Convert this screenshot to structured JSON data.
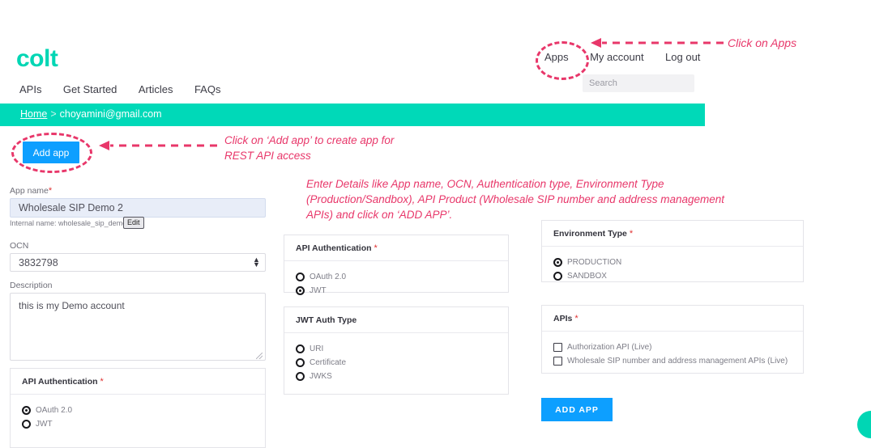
{
  "brand": {
    "logo_text": "colt",
    "logo_color": "#00d6b4",
    "bar_color": "#00d9b8"
  },
  "header": {
    "main_nav": [
      {
        "label": "APIs"
      },
      {
        "label": "Get Started"
      },
      {
        "label": "Articles"
      },
      {
        "label": "FAQs"
      }
    ],
    "user_nav": [
      {
        "label": "Apps"
      },
      {
        "label": "My account"
      },
      {
        "label": "Log out"
      }
    ],
    "search": {
      "placeholder": "Search",
      "value": ""
    }
  },
  "breadcrumb": {
    "home": "Home",
    "separator": ">",
    "current": "choyamini@gmail.com"
  },
  "toolbar": {
    "add_app_label": "Add app"
  },
  "annotations": [
    {
      "id": "apps",
      "text": "Click on Apps",
      "color": "#e8376a"
    },
    {
      "id": "add_app",
      "text": "Click on ‘Add app’ to create app for\nREST API access",
      "color": "#e8376a"
    },
    {
      "id": "details",
      "text": "Enter Details like App name, OCN, Authentication type, Environment Type\n(Production/Sandbox), API Product (Wholesale SIP number and address management\nAPIs) and click on ‘ADD APP’.",
      "color": "#e8376a"
    }
  ],
  "form": {
    "app_name": {
      "label": "App name",
      "required": "*",
      "value": "Wholesale SIP Demo 2",
      "placeholder": "App name",
      "internal_name": "Internal name: wholesale_sip_demo_2",
      "edit_label": "Edit"
    },
    "ocn": {
      "label": "OCN",
      "value": "3832798"
    },
    "description": {
      "label": "Description",
      "value": "this is my Demo account",
      "placeholder": "Description"
    }
  },
  "panels": {
    "api_auth_left": {
      "title": "API Authentication",
      "required": "*",
      "options": [
        {
          "label": "OAuth 2.0",
          "selected": true
        },
        {
          "label": "JWT",
          "selected": false
        }
      ]
    },
    "api_auth_mid": {
      "title": "API Authentication",
      "required": "*",
      "options": [
        {
          "label": "OAuth 2.0",
          "selected": false
        },
        {
          "label": "JWT",
          "selected": true
        }
      ]
    },
    "jwt_auth_type": {
      "title": "JWT Auth Type",
      "required": "",
      "options": [
        {
          "label": "URI",
          "selected": false
        },
        {
          "label": "Certificate",
          "selected": false
        },
        {
          "label": "JWKS",
          "selected": false
        }
      ]
    },
    "environment_type": {
      "title": "Environment Type",
      "required": "*",
      "options": [
        {
          "label": "PRODUCTION",
          "selected": true
        },
        {
          "label": "SANDBOX",
          "selected": false
        }
      ]
    },
    "apis": {
      "title": "APIs",
      "required": "*",
      "options": [
        {
          "label": "Authorization API (Live)",
          "checked": false
        },
        {
          "label": "Wholesale SIP number and address management APIs (Live)",
          "checked": false
        }
      ]
    }
  },
  "submit": {
    "label": "ADD APP"
  }
}
